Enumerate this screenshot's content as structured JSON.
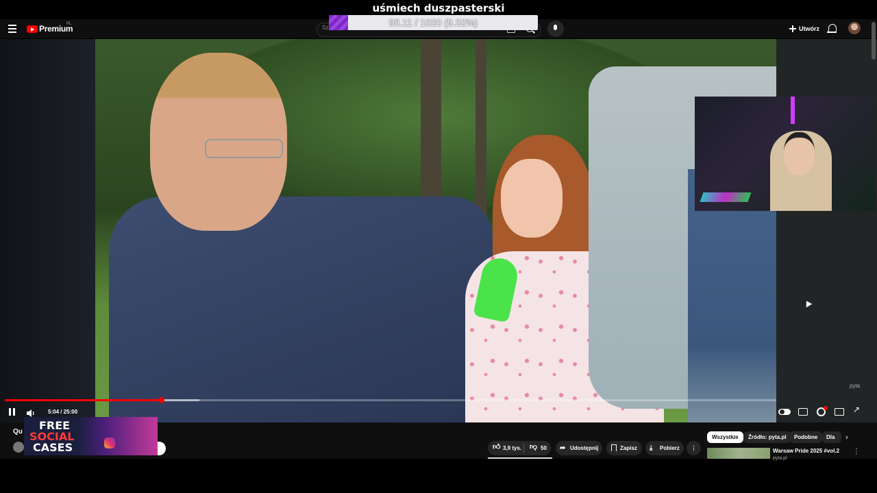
{
  "stream_overlay": {
    "title": "uśmiech duszpasterski",
    "goal_text": "95.11 / 1020 (9.32%)",
    "goal_progress_fraction": 0.0932,
    "goal_color": "#8a36d2"
  },
  "header": {
    "logo_label": "Premium",
    "logo_region": "PL",
    "search_placeholder": "Szukaj",
    "create_label": "Utwórz",
    "icons": [
      "menu-icon",
      "youtube-logo-icon",
      "keyboard-icon",
      "search-icon",
      "mic-icon",
      "plus-icon",
      "bell-icon",
      "avatar"
    ],
    "brand_color": "#ff0000"
  },
  "player": {
    "time": "5:04 / 25:00",
    "progress_fraction": 0.2027,
    "buffer_fraction": 0.2523,
    "progress_color": "#ff0000",
    "watermark": "pyta",
    "controls": [
      "pause-icon",
      "volume-icon",
      "autoplay-toggle",
      "subtitles-icon",
      "settings-icon",
      "miniplayer-icon",
      "fullscreen-icon"
    ]
  },
  "below_video": {
    "title_fragment": "Qu",
    "ad": {
      "line1": "FREE",
      "line2": "SOCIAL",
      "line3": "CASES"
    },
    "actions": {
      "likes": "3,9 tys.",
      "dislikes": "50",
      "share": "Udostępnij",
      "save": "Zapisz",
      "download": "Pobierz",
      "more": "⋮"
    }
  },
  "sidebar": {
    "chips": [
      "Wszystkie",
      "Źródło: pyta.pl",
      "Podobne",
      "Dla"
    ],
    "next_icon": "›",
    "recommendation": {
      "title": "Warsaw Pride 2025 #vol.2",
      "channel": "pyta.pl"
    }
  }
}
